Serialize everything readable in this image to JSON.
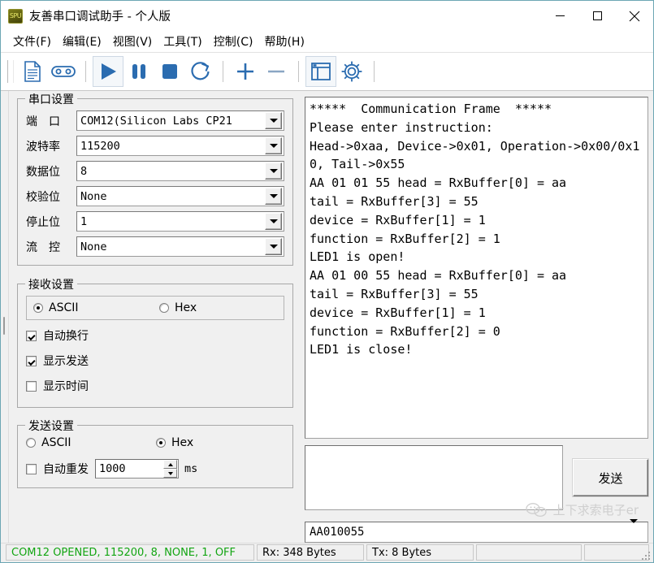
{
  "window": {
    "title": "友善串口调试助手 - 个人版",
    "app_icon_label": "SPU",
    "minimize_icon": "minimize-icon",
    "maximize_icon": "maximize-icon",
    "close_icon": "close-icon"
  },
  "menubar": {
    "items": [
      {
        "label": "文件(F)"
      },
      {
        "label": "编辑(E)"
      },
      {
        "label": "视图(V)"
      },
      {
        "label": "工具(T)"
      },
      {
        "label": "控制(C)"
      },
      {
        "label": "帮助(H)"
      }
    ]
  },
  "toolbar": {
    "buttons": [
      {
        "name": "new-file-icon"
      },
      {
        "name": "connect-icon"
      },
      {
        "name": "play-icon"
      },
      {
        "name": "pause-icon"
      },
      {
        "name": "stop-icon"
      },
      {
        "name": "refresh-icon"
      },
      {
        "name": "add-icon"
      },
      {
        "name": "remove-icon"
      },
      {
        "name": "window-layout-icon"
      },
      {
        "name": "settings-gear-icon"
      }
    ],
    "accent_color": "#2b6cb0"
  },
  "serial_settings": {
    "title": "串口设置",
    "fields": [
      {
        "label": "端　口",
        "value": "COM12(Silicon Labs CP21"
      },
      {
        "label": "波特率",
        "value": "115200"
      },
      {
        "label": "数据位",
        "value": "8"
      },
      {
        "label": "校验位",
        "value": "None"
      },
      {
        "label": "停止位",
        "value": "1"
      },
      {
        "label": "流　控",
        "value": "None"
      }
    ]
  },
  "receive_settings": {
    "title": "接收设置",
    "format_ascii": "ASCII",
    "format_hex": "Hex",
    "selected_format": "ASCII",
    "options": [
      {
        "label": "自动换行",
        "checked": true
      },
      {
        "label": "显示发送",
        "checked": true
      },
      {
        "label": "显示时间",
        "checked": false
      }
    ]
  },
  "send_settings": {
    "title": "发送设置",
    "format_ascii": "ASCII",
    "format_hex": "Hex",
    "selected_format": "Hex",
    "auto_resend_label": "自动重发",
    "auto_resend_checked": false,
    "interval_value": "1000",
    "interval_unit": "ms"
  },
  "terminal": {
    "content": "*****  Communication Frame  *****\nPlease enter instruction:\nHead->0xaa, Device->0x01, Operation->0x00/0x10, Tail->0x55\nAA 01 01 55 head = RxBuffer[0] = aa\ntail = RxBuffer[3] = 55\ndevice = RxBuffer[1] = 1\nfunction = RxBuffer[2] = 1\nLED1 is open!\nAA 01 00 55 head = RxBuffer[0] = aa\ntail = RxBuffer[3] = 55\ndevice = RxBuffer[1] = 1\nfunction = RxBuffer[2] = 0\nLED1 is close!"
  },
  "send_area": {
    "input_value": "",
    "send_button_label": "发送",
    "history_value": "AA010055"
  },
  "watermark": {
    "text": "上下求索电子er",
    "icon": "wechat-icon"
  },
  "statusbar": {
    "connection": "COM12 OPENED, 115200, 8, NONE, 1, OFF",
    "connection_color": "#12a512",
    "rx": "Rx: 348 Bytes",
    "tx": "Tx: 8 Bytes",
    "cell4": "",
    "cell5": ""
  }
}
